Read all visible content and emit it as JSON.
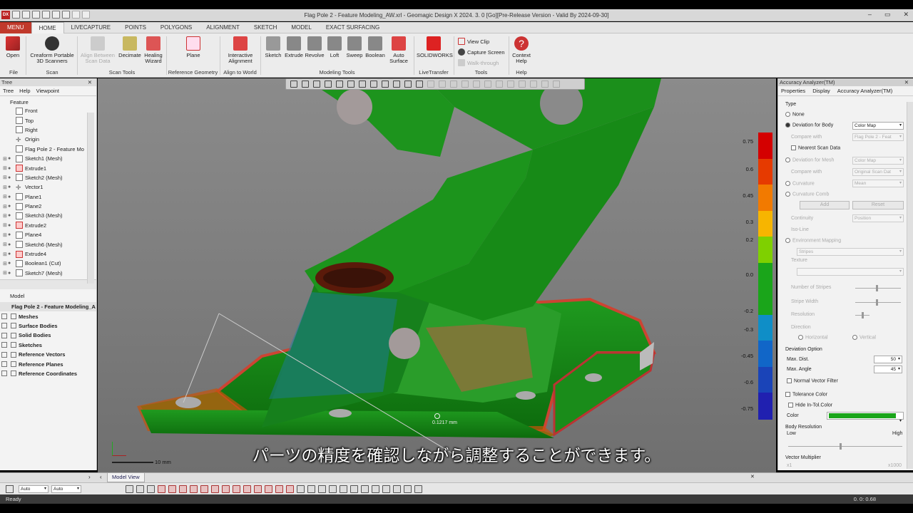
{
  "window": {
    "title": "Flag Pole 2 - Feature Modeling_AW.xrl - Geomagic Design X 2024. 3. 0 [Go][Pre-Release Version - Valid By 2024-09-30]",
    "app_logo": "DX",
    "controls": [
      "–",
      "▭",
      "✕"
    ]
  },
  "tabs": [
    "MENU",
    "HOME",
    "LIVECAPTURE",
    "POINTS",
    "POLYGONS",
    "ALIGNMENT",
    "SKETCH",
    "MODEL",
    "EXACT SURFACING"
  ],
  "ribbon": {
    "open": "Open",
    "creaform": "Creaform Portable 3D Scanners",
    "align_between": "Align Between Scan Data",
    "decimate": "Decimate",
    "healing": "Healing Wizard",
    "plane": "Plane",
    "interactive": "Interactive Alignment",
    "sketch": "Sketch",
    "extrude": "Extrude",
    "revolve": "Revolve",
    "loft": "Loft",
    "sweep": "Sweep",
    "boolean": "Boolean",
    "auto_surface": "Auto Surface",
    "solidworks": "SOLIDWORKS",
    "view_clip": "View Clip",
    "capture_screen": "Capture Screen",
    "walk_through": "Walk-through",
    "context_help": "Context Help",
    "groups": {
      "file": "File",
      "scan": "Scan",
      "scan_tools": "Scan Tools",
      "ref_geom": "Reference Geometry",
      "align_world": "Align to World",
      "modeling_tools": "Modeling Tools",
      "livetransfer": "LiveTransfer",
      "tools": "Tools",
      "help": "Help"
    }
  },
  "left_panel": {
    "title": "Tree",
    "subtabs": [
      "Tree",
      "Help",
      "Viewpoint"
    ],
    "feature_header": "Feature",
    "features": [
      "Front",
      "Top",
      "Right",
      "Origin",
      "Flag Pole 2 - Feature Mo",
      "Sketch1 (Mesh)",
      "Extrude1",
      "Sketch2 (Mesh)",
      "Vector1",
      "Plane1",
      "Plane2",
      "Sketch3 (Mesh)",
      "Extrude2",
      "Plane4",
      "Sketch6 (Mesh)",
      "Extrude4",
      "Boolean1 (Cut)",
      "Sketch7 (Mesh)"
    ],
    "model_header": "Model",
    "model_root": "Flag Pole 2 - Feature Modeling_A",
    "model_items": [
      "Meshes",
      "Surface Bodies",
      "Solid Bodies",
      "Sketches",
      "Reference Vectors",
      "Reference Planes",
      "Reference Coordinates"
    ]
  },
  "viewport": {
    "scale_label": "10 mm",
    "measure_label": "0.1217 mm"
  },
  "colorbar": {
    "labels": [
      "0.75",
      "0.6",
      "0.45",
      "0.3",
      "0.2",
      "0.0",
      "-0.2",
      "-0.3",
      "-0.45",
      "-0.6",
      "-0.75"
    ],
    "colors": [
      "#d40000",
      "#e63a00",
      "#f27a00",
      "#f7b500",
      "#7fd000",
      "#1aa51a",
      "#1aa51a",
      "#0f8ec7",
      "#1166c8",
      "#1a44b8",
      "#2020b0"
    ]
  },
  "right_panel": {
    "title": "Accuracy Analyzer(TM)",
    "subtabs": [
      "Properties",
      "Display",
      "Accuracy Analyzer(TM)"
    ],
    "type": "Type",
    "none": "None",
    "deviation_body": "Deviation for Body",
    "deviation_body_val": "Color Map",
    "compare_with": "Compare with",
    "compare_with_val": "Flag Pole 2 - Feat",
    "nearest": "Nearest Scan Data",
    "deviation_mesh": "Deviation for Mesh",
    "deviation_mesh_val": "Color Map",
    "compare_with2": "Compare with",
    "compare_with2_val": "Original Scan Dat",
    "curvature": "Curvature",
    "curvature_val": "Mean",
    "curvature_comb": "Curvature Comb",
    "add": "Add",
    "reset": "Reset",
    "continuity": "Continuity",
    "continuity_val": "Position",
    "isoline": "Iso-Line",
    "env_mapping": "Environment Mapping",
    "stripes": "Stripes",
    "texture": "Texture",
    "num_stripes": "Number of Stripes",
    "stripe_width": "Stripe Width",
    "resolution": "Resolution",
    "direction": "Direction",
    "horizontal": "Horizontal",
    "vertical": "Vertical",
    "deviation_option": "Deviation Option",
    "max_dist": "Max. Dist.",
    "max_dist_val": "50",
    "max_angle": "Max. Angle",
    "max_angle_val": "45",
    "normal_vector": "Normal Vector Filter",
    "tolerance_color": "Tolerance Color",
    "hide_in_tol": "Hide In-Tol.Color",
    "color": "Color",
    "tol_color_hex": "#1aa51a",
    "body_res": "Body Resolution",
    "low": "Low",
    "high": "High",
    "vector_mult": "Vector Multiplier",
    "x1": "x1",
    "x1000": "x1000"
  },
  "bottom": {
    "model_view": "Model View",
    "auto1": "Auto",
    "auto2": "Auto"
  },
  "status": {
    "ready": "Ready",
    "time": "0. 0: 0.68"
  },
  "subtitle": "パーツの精度を確認しながら調整することができます。"
}
